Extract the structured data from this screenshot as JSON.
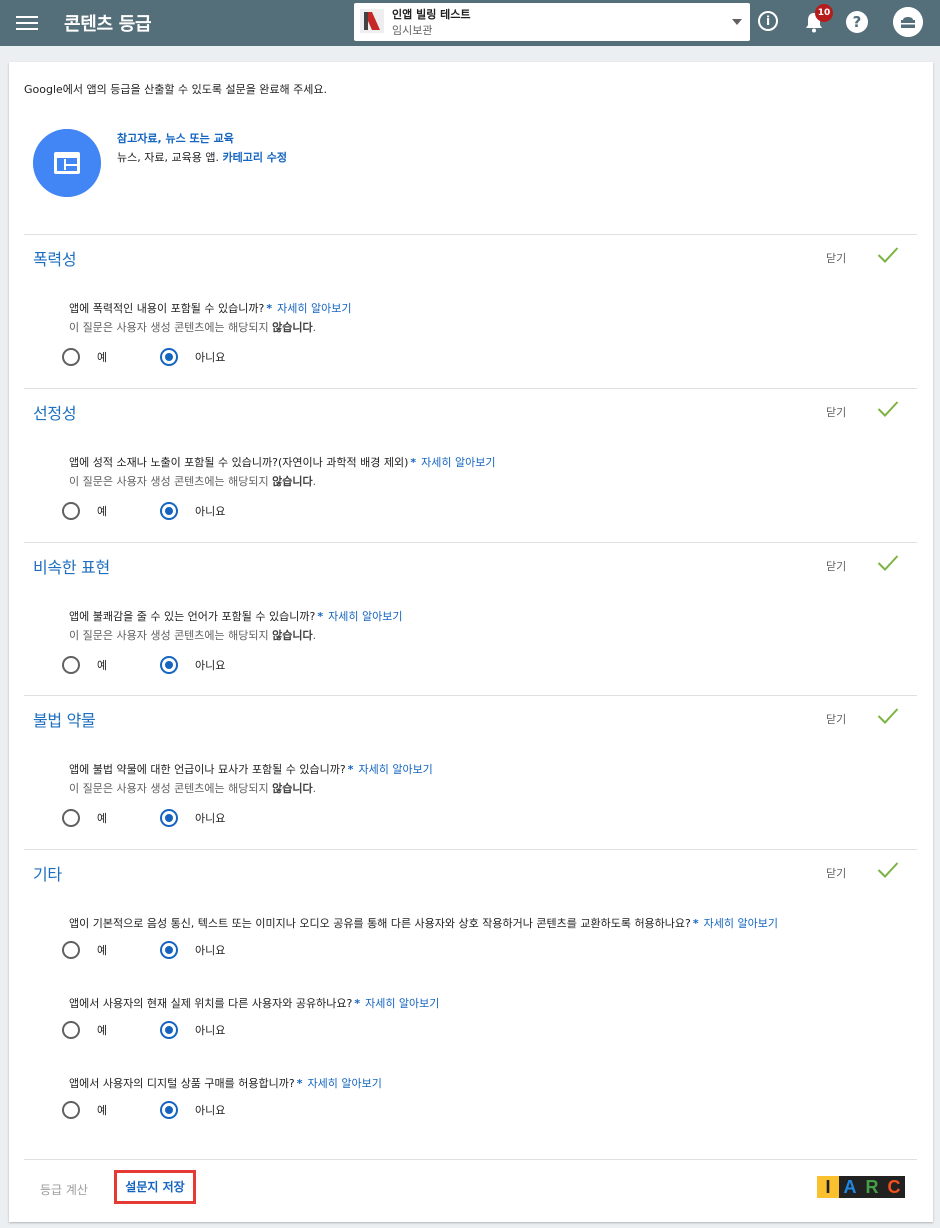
{
  "topbar": {
    "title": "콘텐츠 등급",
    "app_name": "인앱 빌링 테스트",
    "app_status": "임시보관",
    "notification_count": "10",
    "info_glyph": "i",
    "help_glyph": "?"
  },
  "intro": "Google에서 앱의 등급을 산출할 수 있도록 설문을 완료해 주세요.",
  "category": {
    "title": "참고자료, 뉴스 또는 교육",
    "desc": "뉴스, 자료, 교육용 앱.",
    "edit_link": "카테고리 수정"
  },
  "common": {
    "close": "닫기",
    "yes": "예",
    "no": "아니요",
    "learn_more": "자세히 알아보기",
    "star": "*",
    "note_prefix": "이 질문은 사용자 생성 콘텐츠에는 해당되지",
    "note_bold": "않습니다",
    "note_suffix": "."
  },
  "sections": [
    {
      "title": "폭력성",
      "questions": [
        {
          "text": "앱에 폭력적인 내용이 포함될 수 있습니까?",
          "answer": "아니요",
          "has_note": true
        }
      ]
    },
    {
      "title": "선정성",
      "questions": [
        {
          "text": "앱에 성적 소재나 노출이 포함될 수 있습니까?(자연이나 과학적 배경 제외)",
          "answer": "아니요",
          "has_note": true
        }
      ]
    },
    {
      "title": "비속한 표현",
      "questions": [
        {
          "text": "앱에 불쾌감을 줄 수 있는 언어가 포함될 수 있습니까?",
          "answer": "아니요",
          "has_note": true
        }
      ]
    },
    {
      "title": "불법 약물",
      "questions": [
        {
          "text": "앱에 불법 약물에 대한 언급이나 묘사가 포함될 수 있습니까?",
          "answer": "아니요",
          "has_note": true
        }
      ]
    },
    {
      "title": "기타",
      "questions": [
        {
          "text": "앱이 기본적으로 음성 통신, 텍스트 또는 이미지나 오디오 공유를 통해 다른 사용자와 상호 작용하거나 콘텐츠를 교환하도록 허용하나요?",
          "answer": "아니요",
          "has_note": false
        },
        {
          "text": "앱에서 사용자의 현재 실제 위치를 다른 사용자와 공유하나요?",
          "answer": "아니요",
          "has_note": false
        },
        {
          "text": "앱에서 사용자의 디지털 상품 구매를 허용합니까?",
          "answer": "아니요",
          "has_note": false
        }
      ]
    }
  ],
  "footer": {
    "calc_label": "등급 계산",
    "save_label": "설문지 저장",
    "iarc_letters": [
      "I",
      "A",
      "R",
      "C"
    ],
    "iarc_colors": [
      "#212121",
      "#1e88e5",
      "#43a047",
      "#f4511e"
    ],
    "iarc_bg": [
      "#fbc02d",
      "#212121",
      "#212121",
      "#212121"
    ]
  },
  "colors": {
    "topbar": "#546e7a",
    "accent": "#1565c0",
    "check": "#7cb342",
    "save_highlight": "#e53935"
  }
}
